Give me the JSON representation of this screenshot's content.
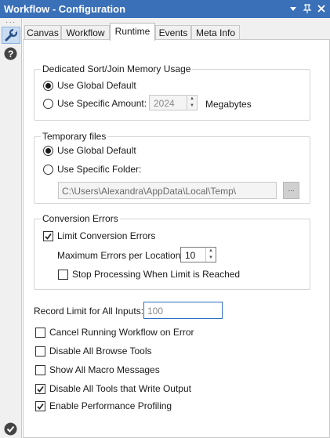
{
  "window": {
    "title": "Workflow - Configuration"
  },
  "tabs": [
    "Canvas",
    "Workflow",
    "Runtime",
    "Events",
    "Meta Info"
  ],
  "active_tab": "Runtime",
  "memory": {
    "label": "Dedicated Sort/Join Memory Usage",
    "global": "Use Global Default",
    "specific": "Use Specific Amount:",
    "amount": "2024",
    "unit": "Megabytes"
  },
  "temp": {
    "label": "Temporary files",
    "global": "Use Global Default",
    "specific": "Use Specific Folder:",
    "path": "C:\\Users\\Alexandra\\AppData\\Local\\Temp\\",
    "browse": "..."
  },
  "conversion": {
    "label": "Conversion Errors",
    "limit": "Limit Conversion Errors",
    "max_label": "Maximum Errors per Location:",
    "max_value": "10",
    "stop": "Stop Processing When Limit is Reached"
  },
  "record_limit": {
    "label": "Record Limit for All Inputs:",
    "value": "100"
  },
  "options": {
    "cancel": "Cancel Running Workflow on Error",
    "disable_browse": "Disable All Browse Tools",
    "show_macro": "Show All Macro Messages",
    "disable_output": "Disable All Tools that Write Output",
    "profiling": "Enable Performance Profiling"
  },
  "colors": {
    "titlebar": "#3a70b8",
    "focus": "#2e6fbf"
  }
}
